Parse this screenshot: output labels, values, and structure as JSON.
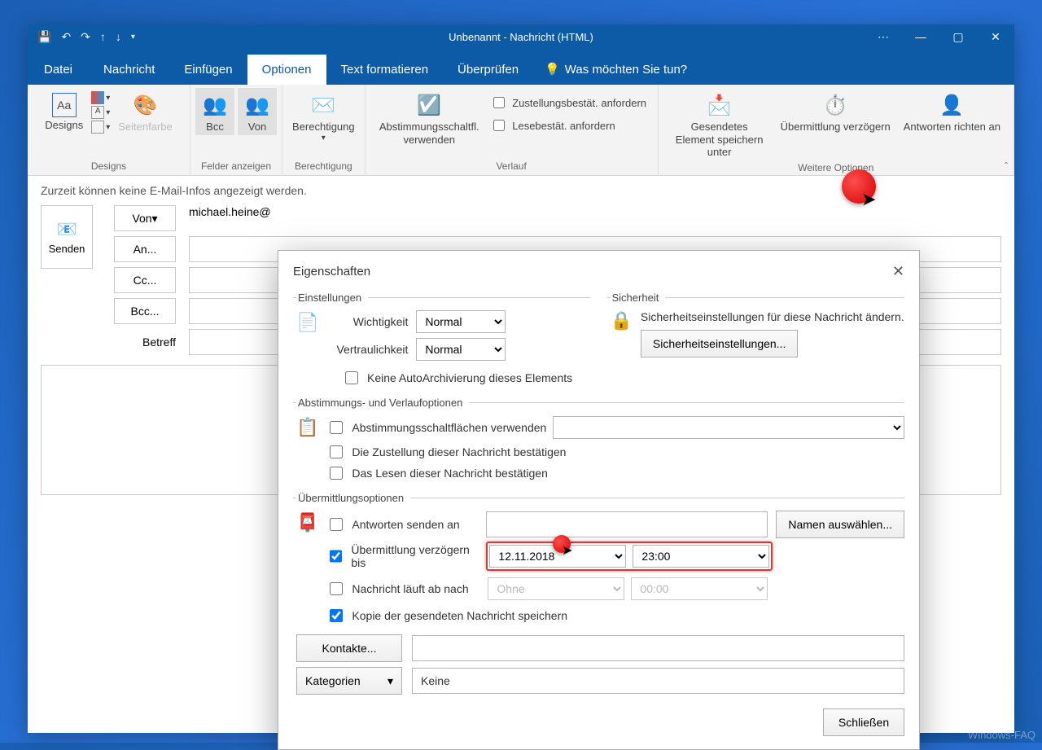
{
  "window": {
    "title": "Unbenannt - Nachricht (HTML)"
  },
  "tabs": {
    "datei": "Datei",
    "nachricht": "Nachricht",
    "einfuegen": "Einfügen",
    "optionen": "Optionen",
    "text_formatieren": "Text formatieren",
    "ueberpruefen": "Überprüfen",
    "tellme": "Was möchten Sie tun?"
  },
  "ribbon": {
    "designs": "Designs",
    "designs_btn": "Designs",
    "seitenfarbe": "Seitenfarbe",
    "bcc": "Bcc",
    "von": "Von",
    "felder_anzeigen": "Felder anzeigen",
    "berechtigung": "Berechtigung",
    "berechtigung_group": "Berechtigung",
    "abstimmung": "Abstimmungsschaltfl. verwenden",
    "zustellung": "Zustellungsbestät. anfordern",
    "lesebest": "Lesebestät. anfordern",
    "verlauf": "Verlauf",
    "gesendetes": "Gesendetes Element speichern unter",
    "uebermittlung": "Übermittlung verzögern",
    "antworten": "Antworten richten an",
    "weitere_optionen": "Weitere Optionen"
  },
  "infobar": "Zurzeit können keine E-Mail-Infos angezeigt werden.",
  "compose": {
    "senden": "Senden",
    "von_btn": "Von",
    "von_value": "michael.heine@",
    "an": "An...",
    "cc": "Cc...",
    "bcc": "Bcc...",
    "betreff": "Betreff"
  },
  "dialog": {
    "title": "Eigenschaften",
    "einstellungen": "Einstellungen",
    "sicherheit": "Sicherheit",
    "wichtigkeit": "Wichtigkeit",
    "wichtigkeit_val": "Normal",
    "vertraulichkeit": "Vertraulichkeit",
    "vertraulichkeit_val": "Normal",
    "keine_autoarchiv": "Keine AutoArchivierung dieses Elements",
    "sicherheit_text": "Sicherheitseinstellungen für diese Nachricht ändern.",
    "sicherheit_btn": "Sicherheitseinstellungen...",
    "abstimmung_legend": "Abstimmungs- und Verlaufoptionen",
    "abstimmung_chk": "Abstimmungsschaltflächen verwenden",
    "zustellung_chk": "Die Zustellung dieser Nachricht bestätigen",
    "lesen_chk": "Das Lesen dieser Nachricht bestätigen",
    "uebermittlung_legend": "Übermittlungsoptionen",
    "antworten_chk": "Antworten senden an",
    "namen_btn": "Namen auswählen...",
    "verzoegern_chk": "Übermittlung verzögern bis",
    "verzoegern_date": "12.11.2018",
    "verzoegern_time": "23:00",
    "ablauf_chk": "Nachricht läuft ab nach",
    "ablauf_date": "Ohne",
    "ablauf_time": "00:00",
    "kopie_chk": "Kopie der gesendeten Nachricht speichern",
    "kontakte_btn": "Kontakte...",
    "kategorien_btn": "Kategorien",
    "kategorien_val": "Keine",
    "schliessen": "Schließen"
  },
  "watermark": "Windows-FAQ"
}
